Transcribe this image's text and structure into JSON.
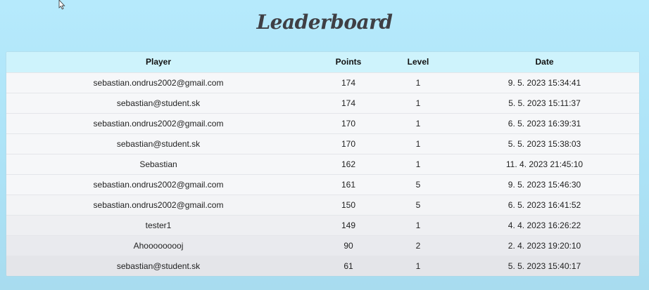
{
  "title": "Leaderboard",
  "table": {
    "headers": {
      "player": "Player",
      "points": "Points",
      "level": "Level",
      "date": "Date"
    },
    "rows": [
      {
        "player": "sebastian.ondrus2002@gmail.com",
        "points": "174",
        "level": "1",
        "date": "9. 5. 2023 15:34:41"
      },
      {
        "player": "sebastian@student.sk",
        "points": "174",
        "level": "1",
        "date": "5. 5. 2023 15:11:37"
      },
      {
        "player": "sebastian.ondrus2002@gmail.com",
        "points": "170",
        "level": "1",
        "date": "6. 5. 2023 16:39:31"
      },
      {
        "player": "sebastian@student.sk",
        "points": "170",
        "level": "1",
        "date": "5. 5. 2023 15:38:03"
      },
      {
        "player": "Sebastian",
        "points": "162",
        "level": "1",
        "date": "11. 4. 2023 21:45:10"
      },
      {
        "player": "sebastian.ondrus2002@gmail.com",
        "points": "161",
        "level": "5",
        "date": "9. 5. 2023 15:46:30"
      },
      {
        "player": "sebastian.ondrus2002@gmail.com",
        "points": "150",
        "level": "5",
        "date": "6. 5. 2023 16:41:52"
      },
      {
        "player": "tester1",
        "points": "149",
        "level": "1",
        "date": "4. 4. 2023 16:26:22"
      },
      {
        "player": "Ahooooooooj",
        "points": "90",
        "level": "2",
        "date": "2. 4. 2023 19:20:10"
      },
      {
        "player": "sebastian@student.sk",
        "points": "61",
        "level": "1",
        "date": "5. 5. 2023 15:40:17"
      }
    ]
  },
  "colors": {
    "background": "#b6eafc",
    "header_row": "#cef3fc",
    "title_text": "#3f3f44"
  },
  "icons": {
    "cursor": "mouse-pointer-icon"
  }
}
